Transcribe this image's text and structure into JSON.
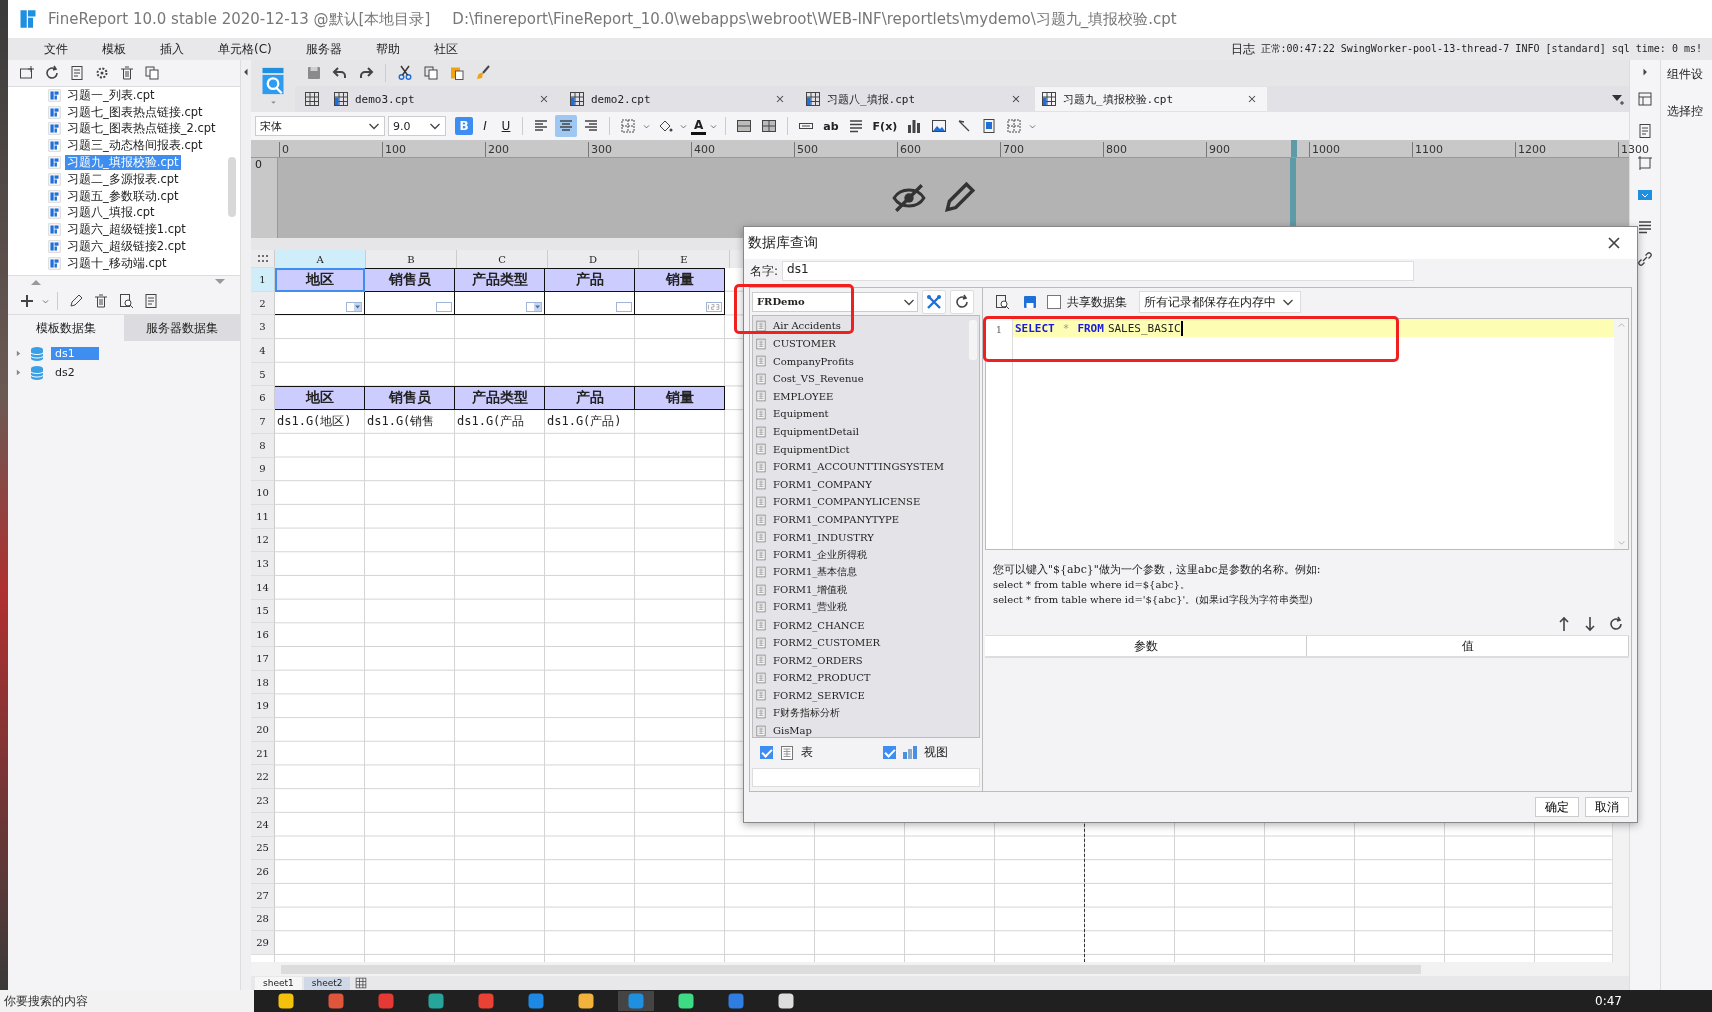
{
  "window": {
    "title": "FineReport 10.0 stable 2020-12-13 @默认[本地目录]",
    "path": "D:\\finereport\\FineReport_10.0\\webapps\\webroot\\WEB-INF\\reportlets\\mydemo\\习题九_填报校验.cpt"
  },
  "menu": [
    "文件",
    "模板",
    "插入",
    "单元格(C)",
    "服务器",
    "帮助",
    "社区"
  ],
  "log": {
    "label": "日志",
    "message": "正常:00:47:22 SwingWorker-pool-13-thread-7 INFO [standard] sql time: 0 ms!"
  },
  "file_tree": [
    {
      "label": "习题一_列表.cpt",
      "selected": false
    },
    {
      "label": "习题七_图表热点链接.cpt",
      "selected": false
    },
    {
      "label": "习题七_图表热点链接_2.cpt",
      "selected": false
    },
    {
      "label": "习题三_动态格间报表.cpt",
      "selected": false
    },
    {
      "label": "习题九_填报校验.cpt",
      "selected": true
    },
    {
      "label": "习题二_多源报表.cpt",
      "selected": false
    },
    {
      "label": "习题五_参数联动.cpt",
      "selected": false
    },
    {
      "label": "习题八_填报.cpt",
      "selected": false
    },
    {
      "label": "习题六_超级链接1.cpt",
      "selected": false
    },
    {
      "label": "习题六_超级链接2.cpt",
      "selected": false
    },
    {
      "label": "习题十_移动端.cpt",
      "selected": false
    }
  ],
  "dataset_tabs": [
    {
      "label": "模板数据集",
      "selected": true
    },
    {
      "label": "服务器数据集",
      "selected": false
    }
  ],
  "datasets": [
    {
      "label": "ds1",
      "selected": true
    },
    {
      "label": "ds2",
      "selected": false
    }
  ],
  "tabs": [
    {
      "label": "demo3.cpt",
      "selected": false
    },
    {
      "label": "demo2.cpt",
      "selected": false
    },
    {
      "label": "习题八_填报.cpt",
      "selected": false
    },
    {
      "label": "习题九_填报校验.cpt",
      "selected": true
    }
  ],
  "format": {
    "font": "宋体",
    "size": "9.0",
    "styles": [
      {
        "label": "B",
        "on": true
      },
      {
        "label": "I",
        "on": false
      },
      {
        "label": "U",
        "on": false
      }
    ],
    "align": [
      {
        "kind": "left",
        "on": false
      },
      {
        "kind": "center",
        "on": true
      },
      {
        "kind": "right",
        "on": false
      }
    ],
    "font_color": "A",
    "text_tools": [
      "ab",
      "F(x)"
    ]
  },
  "ruler": {
    "ticks": [
      "0",
      "100",
      "200",
      "300",
      "400",
      "500",
      "600",
      "700",
      "800",
      "900",
      "1000",
      "1100",
      "1200",
      "1300"
    ],
    "side": "0"
  },
  "sheet": {
    "columns": [
      {
        "label": "A",
        "selected": true
      },
      {
        "label": "B",
        "selected": false
      },
      {
        "label": "C",
        "selected": false
      },
      {
        "label": "D",
        "selected": false
      },
      {
        "label": "E",
        "selected": false
      }
    ],
    "rows": [
      {
        "number": "1",
        "selected": true,
        "kind": "header",
        "cells": [
          "地区",
          "销售员",
          "产品类型",
          "产品",
          "销量"
        ]
      },
      {
        "number": "2",
        "selected": false,
        "kind": "widgets",
        "cells": [
          {
            "kind": "combo"
          },
          {
            "kind": "text"
          },
          {
            "kind": "combo"
          },
          {
            "kind": "text"
          },
          {
            "kind": "number"
          }
        ]
      },
      {
        "number": "3",
        "selected": false,
        "kind": "empty"
      },
      {
        "number": "4",
        "selected": false,
        "kind": "empty"
      },
      {
        "number": "5",
        "selected": false,
        "kind": "empty"
      },
      {
        "number": "6",
        "selected": false,
        "kind": "header",
        "cells": [
          "地区",
          "销售员",
          "产品类型",
          "产品",
          "销量"
        ]
      },
      {
        "number": "7",
        "selected": false,
        "kind": "formula",
        "cells": [
          "ds1.G(地区)",
          "ds1.G(销售",
          "ds1.G(产品",
          "ds1.G(产品)"
        ]
      },
      {
        "number": "8",
        "selected": false,
        "kind": "empty"
      },
      {
        "number": "9",
        "selected": false,
        "kind": "empty"
      },
      {
        "number": "10",
        "selected": false,
        "kind": "empty"
      },
      {
        "number": "11",
        "selected": false,
        "kind": "empty"
      },
      {
        "number": "12",
        "selected": false,
        "kind": "empty"
      },
      {
        "number": "13",
        "selected": false,
        "kind": "empty"
      },
      {
        "number": "14",
        "selected": false,
        "kind": "empty"
      },
      {
        "number": "15",
        "selected": false,
        "kind": "empty"
      },
      {
        "number": "16",
        "selected": false,
        "kind": "empty"
      },
      {
        "number": "17",
        "selected": false,
        "kind": "empty"
      },
      {
        "number": "18",
        "selected": false,
        "kind": "empty"
      },
      {
        "number": "19",
        "selected": false,
        "kind": "empty"
      },
      {
        "number": "20",
        "selected": false,
        "kind": "empty"
      },
      {
        "number": "21",
        "selected": false,
        "kind": "empty"
      },
      {
        "number": "22",
        "selected": false,
        "kind": "empty"
      },
      {
        "number": "23",
        "selected": false,
        "kind": "empty"
      },
      {
        "number": "24",
        "selected": false,
        "kind": "empty"
      },
      {
        "number": "25",
        "selected": false,
        "kind": "empty"
      },
      {
        "number": "26",
        "selected": false,
        "kind": "empty"
      },
      {
        "number": "27",
        "selected": false,
        "kind": "empty"
      },
      {
        "number": "28",
        "selected": false,
        "kind": "empty"
      },
      {
        "number": "29",
        "selected": false,
        "kind": "empty"
      }
    ],
    "sheet_tabs": [
      {
        "label": "sheet1",
        "selected": false
      },
      {
        "label": "sheet2",
        "selected": true
      }
    ]
  },
  "side_panel": {
    "labels": [
      "组件设",
      "选择控"
    ]
  },
  "dialog": {
    "title": "数据库查询",
    "name_label": "名字:",
    "name_value": "ds1",
    "connection": "FRDemo",
    "tables": [
      "Air Accidents",
      "CUSTOMER",
      "CompanyProfits",
      "Cost_VS_Revenue",
      "EMPLOYEE",
      "Equipment",
      "EquipmentDetail",
      "EquipmentDict",
      "FORM1_ACCOUNTTINGSYSTEM",
      "FORM1_COMPANY",
      "FORM1_COMPANYLICENSE",
      "FORM1_COMPANYTYPE",
      "FORM1_INDUSTRY",
      "FORM1_企业所得税",
      "FORM1_基本信息",
      "FORM1_增值税",
      "FORM1_营业税",
      "FORM2_CHANCE",
      "FORM2_CUSTOMER",
      "FORM2_ORDERS",
      "FORM2_PRODUCT",
      "FORM2_SERVICE",
      "F财务指标分析",
      "GisMap"
    ],
    "filters": [
      {
        "kind": "table",
        "label": "表",
        "checked": true
      },
      {
        "kind": "view",
        "label": "视图",
        "checked": true
      }
    ],
    "share": {
      "label": "共享数据集",
      "checked": false
    },
    "cache": "所有记录都保存在内存中",
    "sql": {
      "line": "1",
      "tokens": [
        {
          "kind": "keyword",
          "text": "SELECT"
        },
        {
          "kind": "operator",
          "text": "*"
        },
        {
          "kind": "keyword",
          "text": "FROM"
        },
        {
          "kind": "name",
          "text": "SALES_BASIC"
        }
      ]
    },
    "hint": [
      "您可以键入\"${abc}\"做为一个参数，这里abc是参数的名称。例如:",
      "select * from table where id=${abc}。",
      "select * from table where id='${abc}'。(如果id字段为字符串类型)"
    ],
    "params": {
      "columns": [
        "参数",
        "值"
      ]
    },
    "buttons": [
      "确定",
      "取消"
    ]
  },
  "taskbar": {
    "search_placeholder": "你要搜索的内容",
    "clock": "0:47"
  }
}
